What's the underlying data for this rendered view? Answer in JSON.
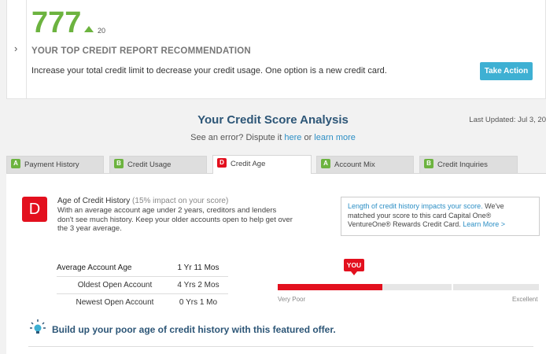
{
  "top": {
    "score": "777",
    "score_change": "20",
    "recommendation_title": "YOUR TOP CREDIT REPORT RECOMMENDATION",
    "recommendation_text": "Increase your total credit limit to decrease your credit usage. One option is a new credit card.",
    "take_action_label": "Take Action",
    "expand_icon": "chevron-right-icon"
  },
  "analysis": {
    "title": "Your Credit Score Analysis",
    "last_updated": "Last Updated: Jul 3, 20",
    "dispute_prefix": "See an error? Dispute it ",
    "dispute_here": "here",
    "dispute_or": " or ",
    "dispute_learn": "learn more"
  },
  "tabs": [
    {
      "grade": "A",
      "label": "Payment History"
    },
    {
      "grade": "B",
      "label": "Credit Usage"
    },
    {
      "grade": "D",
      "label": "Credit Age"
    },
    {
      "grade": "A",
      "label": "Account Mix"
    },
    {
      "grade": "B",
      "label": "Credit Inquiries"
    }
  ],
  "active_tab": "Credit Age",
  "detail": {
    "grade": "D",
    "title": "Age of Credit History",
    "impact": "(15% impact on your score)",
    "description": "With an average account age under 2 years, creditors and lenders don't see much history. Keep your older accounts open to help get over the 3 year average.",
    "promo_link": "Length of credit history impacts your score.",
    "promo_text": " We've matched your score to this card Capital One® VentureOne® Rewards Credit Card. ",
    "promo_more": "Learn More >",
    "stats": [
      {
        "label": "Average Account Age",
        "value": "1 Yr 11 Mos"
      },
      {
        "label": "Oldest Open Account",
        "value": "4 Yrs 2 Mos"
      },
      {
        "label": "Newest Open Account",
        "value": "0 Yrs 1 Mo"
      }
    ],
    "meter": {
      "you_label": "YOU",
      "low_label": "Very Poor",
      "high_label": "Excellent",
      "level": 0.4
    },
    "offer_text": "Build up your poor age of credit history with this featured offer.",
    "offer_icon": "lightbulb-icon"
  },
  "colors": {
    "score_green": "#6cb33f",
    "grade_red": "#e3101e",
    "accent_blue": "#3eb0d3",
    "heading_blue": "#2d5677"
  }
}
